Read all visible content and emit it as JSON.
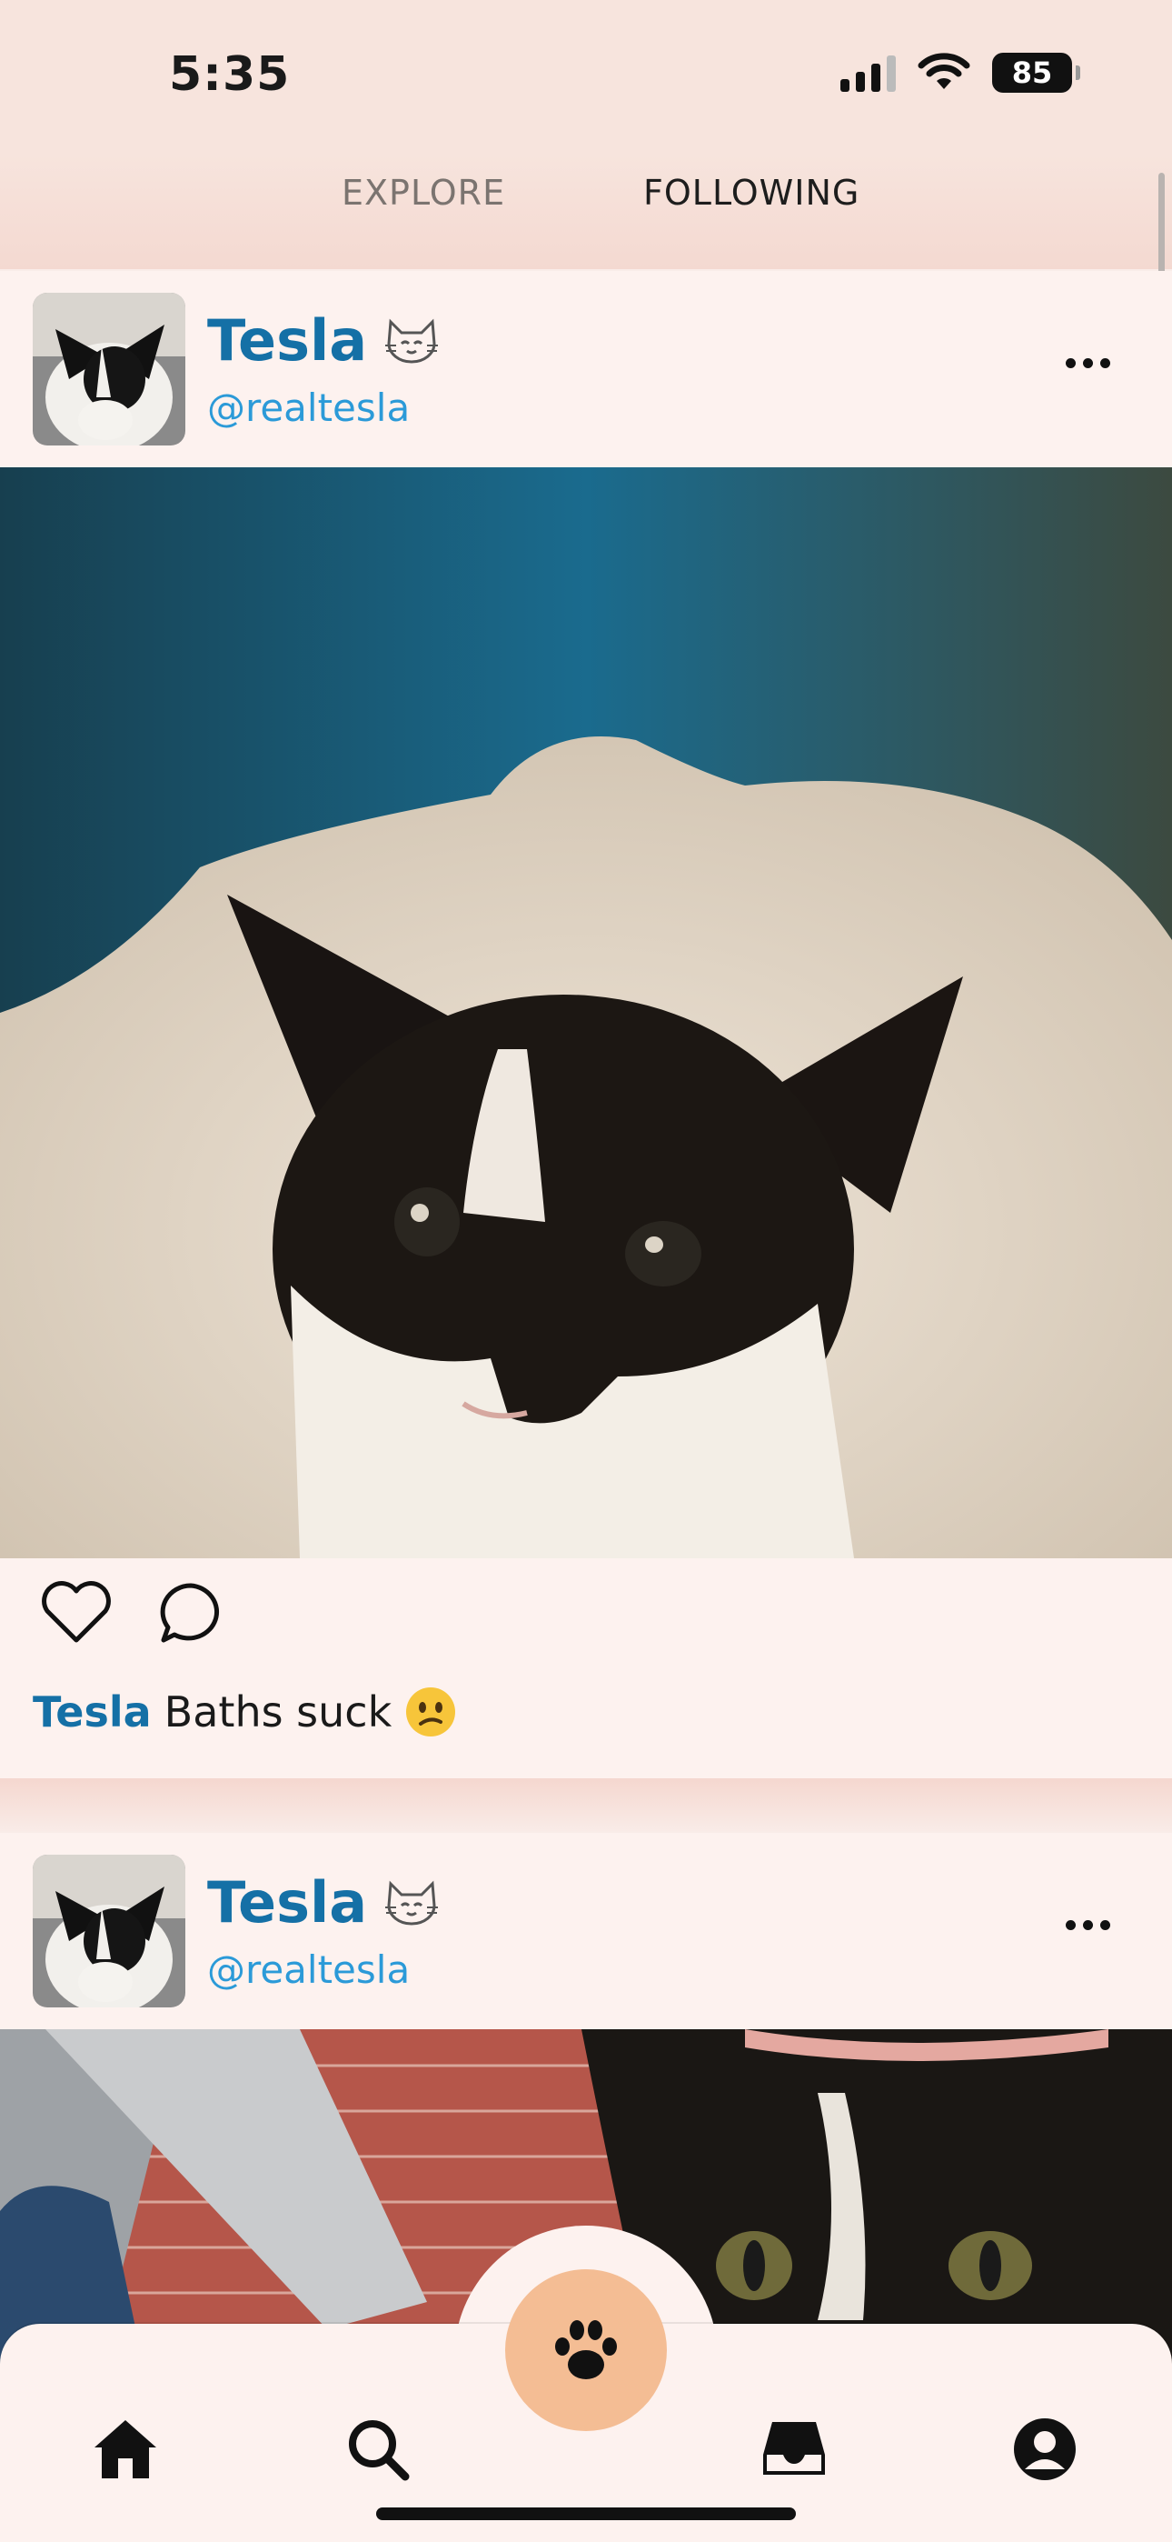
{
  "status_bar": {
    "time": "5:35",
    "battery": "85"
  },
  "tabs": [
    {
      "label": "EXPLORE",
      "active": false
    },
    {
      "label": "FOLLOWING",
      "active": true
    }
  ],
  "posts": [
    {
      "display_name": "Tesla",
      "name_icon": "cat-face-icon",
      "handle": "@realtesla",
      "image": "tuxedo-cat-in-bubble-bath",
      "caption_author": "Tesla",
      "caption_text": "Baths suck",
      "caption_emoji": "confused-face-icon"
    },
    {
      "display_name": "Tesla",
      "name_icon": "cat-face-icon",
      "handle": "@realtesla",
      "image": "tuxedo-cat-in-car"
    }
  ],
  "bottom_nav": {
    "items": [
      "home-icon",
      "search-icon",
      "paw-icon",
      "inbox-icon",
      "profile-icon"
    ],
    "fab_color": "#f4bd94"
  },
  "colors": {
    "name": "#1570a6",
    "handle": "#2b9ad8",
    "background": "#fdf2ef",
    "header": "#f7e4dd"
  }
}
